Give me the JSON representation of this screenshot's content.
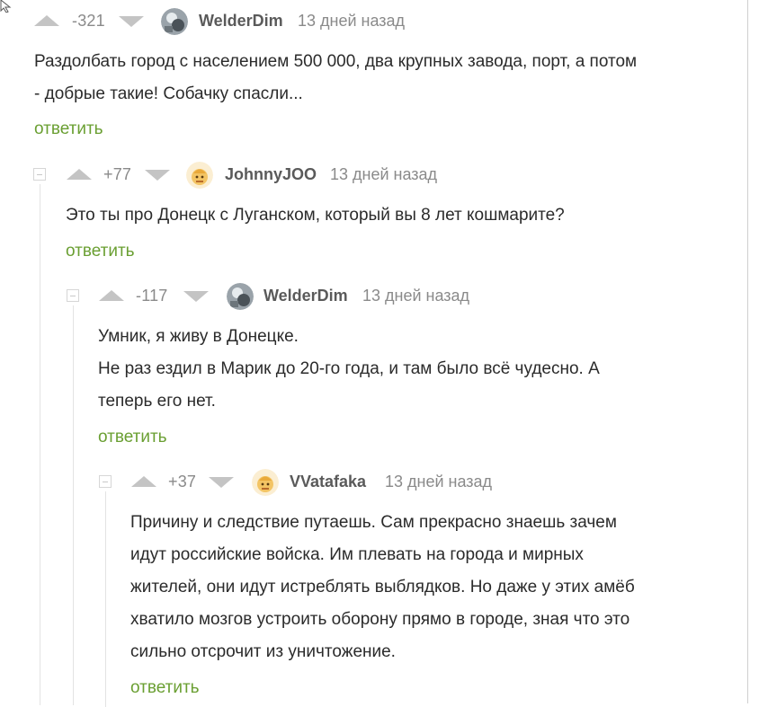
{
  "reply_label": "ответить",
  "comments": [
    {
      "rating": "-321",
      "author": "WelderDim",
      "time": "13 дней назад",
      "lines": [
        "Раздолбать город с населением 500 000, два крупных завода, порт, а потом",
        "- добрые такие! Собачку спасли..."
      ]
    },
    {
      "rating": "+77",
      "author": "JohnnyJOO",
      "time": "13 дней назад",
      "lines": [
        "Это ты про Донецк с Луганском, который вы 8 лет кошмарите?"
      ]
    },
    {
      "rating": "-117",
      "author": "WelderDim",
      "time": "13 дней назад",
      "lines": [
        "Умник, я живу в Донецке.",
        "Не раз ездил в Марик до 20-го года, и там было всё чудесно. А",
        "теперь его нет."
      ]
    },
    {
      "rating": "+37",
      "author": "VVatafaka",
      "time": "13 дней назад",
      "lines": [
        "Причину и следствие путаешь. Сам прекрасно знаешь зачем",
        "идут российские войска. Им плевать на города и мирных",
        "жителей, они идут истреблять выблядков. Но даже у этих амёб",
        "хватило мозгов устроить оборону прямо в городе, зная что это",
        "сильно отсрочит из уничтожение."
      ]
    }
  ]
}
